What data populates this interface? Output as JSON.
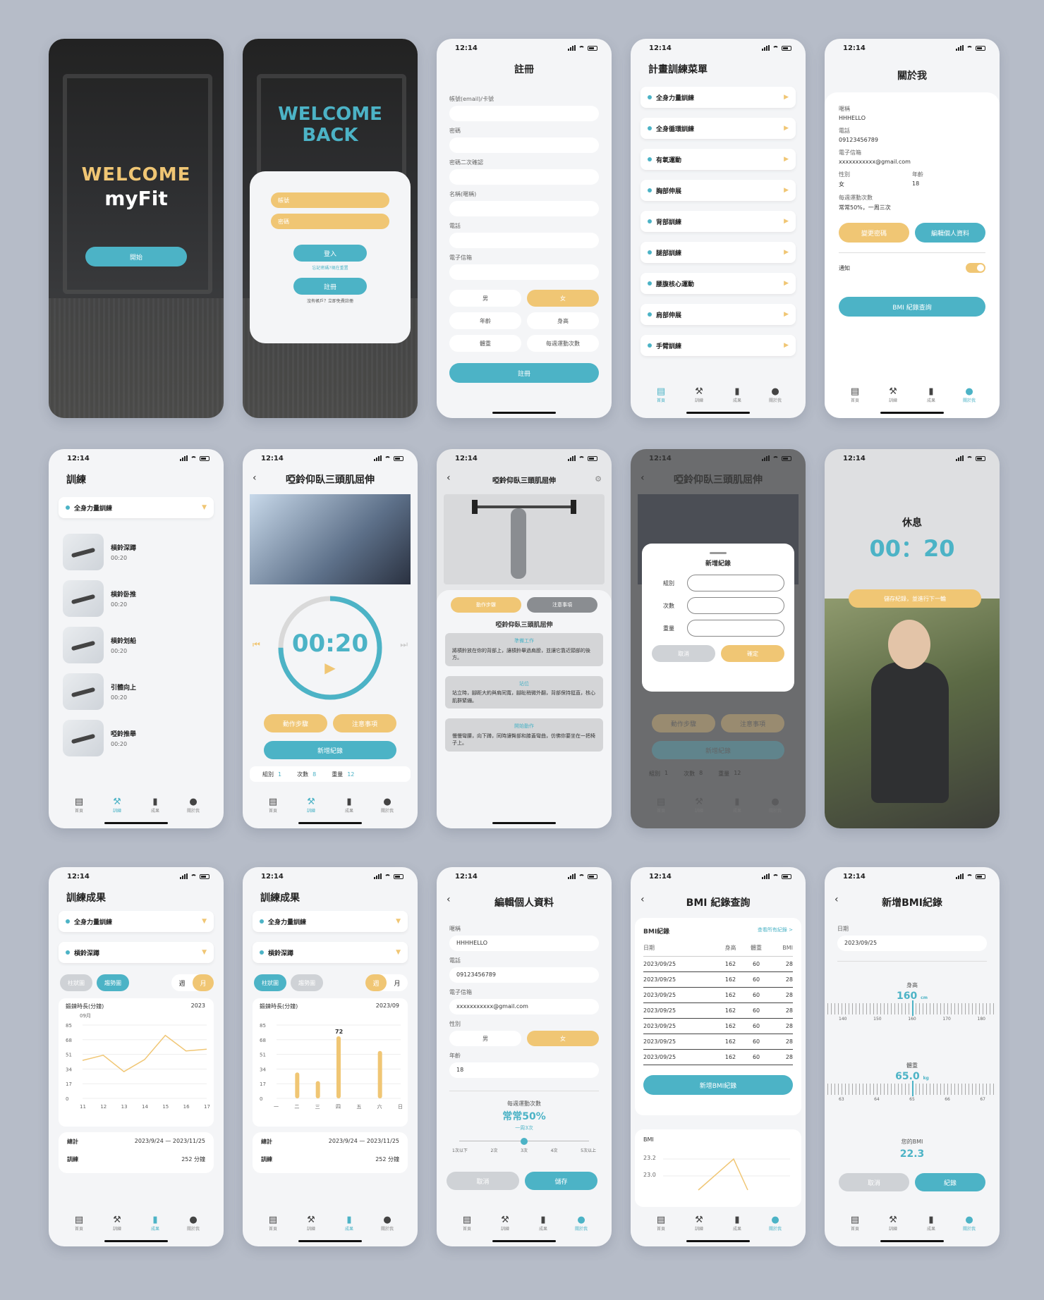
{
  "status": {
    "time": "12:14"
  },
  "nav": [
    "首頁",
    "訓練",
    "成果",
    "關於我"
  ],
  "s1": {
    "welcome": "WELCOME",
    "brand": "myFit",
    "start": "開始"
  },
  "s2": {
    "welcome1": "WELCOME",
    "welcome2": "BACK",
    "account": "帳號",
    "password": "密碼",
    "login": "登入",
    "forgot": "忘記密碼?現在重置",
    "register": "註冊",
    "no_account": "沒有帳戶？立即免費註冊"
  },
  "s3": {
    "title": "註冊",
    "fields": [
      "帳號(email)/卡號",
      "密碼",
      "密碼二次確認",
      "名稱(暱稱)",
      "電話",
      "電子信箱"
    ],
    "male": "男",
    "female": "女",
    "age": "年齡",
    "height": "身高",
    "weight": "體重",
    "freq": "每週運動次數",
    "submit": "註冊"
  },
  "s4": {
    "title": "計畫訓練菜單",
    "items": [
      "全身力量訓練",
      "全身循環訓練",
      "有氧運動",
      "胸部伸展",
      "背部訓練",
      "腿部訓練",
      "腰腹核心運動",
      "肩部伸展",
      "手臂訓練"
    ]
  },
  "s5": {
    "title": "關於我",
    "nick_l": "暱稱",
    "nick": "HHHELLO",
    "phone_l": "電話",
    "phone": "09123456789",
    "email_l": "電子信箱",
    "email": "xxxxxxxxxxx@gmail.com",
    "gender_l": "性別",
    "gender": "女",
    "age_l": "年齡",
    "age": "18",
    "freq_l": "每週運動次數",
    "freq": "常常50%，一周三次",
    "change_pw": "變更密碼",
    "edit": "編輯個人資料",
    "notify": "通知",
    "bmi": "BMI 紀錄查詢"
  },
  "s6": {
    "title": "訓練",
    "select": "全身力量訓練",
    "list": [
      {
        "name": "槓鈴深蹲",
        "time": "00:20"
      },
      {
        "name": "槓鈴卧推",
        "time": "00:20"
      },
      {
        "name": "槓鈴划船",
        "time": "00:20"
      },
      {
        "name": "引體向上",
        "time": "00:20"
      },
      {
        "name": "啞鈴推舉",
        "time": "00:20"
      }
    ]
  },
  "s7": {
    "title": "啞鈴仰臥三頭肌屈伸",
    "timer": "00:20",
    "steps": "動作步驟",
    "notes": "注意事項",
    "add": "新增紀錄",
    "sets_l": "組別",
    "sets": "1",
    "reps_l": "次數",
    "reps": "8",
    "wt_l": "重量",
    "wt": "12"
  },
  "s8": {
    "title": "啞鈴仰臥三頭肌屈伸",
    "tab1": "動作步驟",
    "tab2": "注意事項",
    "sub": "啞鈴仰臥三頭肌屈伸",
    "b1h": "準備工作",
    "b1": "將槓鈴放在你的背部上，讓槓鈴舉過肩膀，並讓它靠近頸部的後方。",
    "b2h": "站位",
    "b2": "站立時，腳距大約與肩同寬，腳趾稍微外翻，背部保持挺直，核心肌群緊繃。",
    "b3h": "開始動作",
    "b3": "慢慢彎腰，向下蹲，同時讓臀部和膝蓋彎曲，仿佛你要坐在一把椅子上。"
  },
  "s9": {
    "title": "啞鈴仰臥三頭肌屈伸",
    "modal": "新增紀錄",
    "sets": "組別",
    "reps": "次數",
    "wt": "重量",
    "cancel": "取消",
    "ok": "確定",
    "steps": "動作步驟",
    "notes": "注意事項",
    "add": "新增紀錄",
    "sets_l": "組別",
    "sets_v": "1",
    "reps_l": "次數",
    "reps_v": "8",
    "wt_l": "重量",
    "wt_v": "12"
  },
  "s10": {
    "rest": "休息",
    "timer": "00：20",
    "save": "儲存紀錄，並進行下一輪"
  },
  "s11": {
    "title": "訓練成果",
    "sel1": "全身力量訓練",
    "sel2": "槓鈴深蹲",
    "bar": "柱狀圖",
    "trend": "趨勢圖",
    "week": "週",
    "month": "月",
    "clabel": "鍛鍊時長(分鐘)",
    "year": "2023",
    "month_label": "09月",
    "total": "總計",
    "range": "2023/9/24 — 2023/11/25",
    "train": "訓練",
    "minutes": "252  分鐘"
  },
  "s12": {
    "title": "訓練成果",
    "sel1": "全身力量訓練",
    "sel2": "槓鈴深蹲",
    "bar": "柱狀圖",
    "trend": "趨勢圖",
    "week": "週",
    "month": "月",
    "clabel": "鍛鍊時長(分鐘)",
    "ym": "2023/09",
    "total": "總計",
    "range": "2023/9/24 — 2023/11/25",
    "train": "訓練",
    "minutes": "252  分鐘"
  },
  "s13": {
    "title": "編輯個人資料",
    "nick_l": "暱稱",
    "nick": "HHHHELLO",
    "phone_l": "電話",
    "phone": "09123456789",
    "email_l": "電子信箱",
    "email": "xxxxxxxxxxx@gmail.com",
    "gender_l": "性別",
    "male": "男",
    "female": "女",
    "age_l": "年齡",
    "age": "18",
    "freq_l": "每週運動次數",
    "freq": "常常50%",
    "freq_sub": "一周3次",
    "ticks": [
      "1次以下",
      "2次",
      "3次",
      "4次",
      "5次以上"
    ],
    "cancel": "取消",
    "save": "儲存"
  },
  "s14": {
    "title": "BMI 紀錄查詢",
    "rec": "BMI紀錄",
    "all": "查看所有紀錄 >",
    "cols": [
      "日期",
      "身高",
      "體重",
      "BMI"
    ],
    "rows": [
      [
        "2023/09/25",
        "162",
        "60",
        "28"
      ],
      [
        "2023/09/25",
        "162",
        "60",
        "28"
      ],
      [
        "2023/09/25",
        "162",
        "60",
        "28"
      ],
      [
        "2023/09/25",
        "162",
        "60",
        "28"
      ],
      [
        "2023/09/25",
        "162",
        "60",
        "28"
      ],
      [
        "2023/09/25",
        "162",
        "60",
        "28"
      ],
      [
        "2023/09/25",
        "162",
        "60",
        "28"
      ]
    ],
    "add": "新增BMI紀錄",
    "bmi_l": "BMI",
    "y1": "23.2",
    "y2": "23.0"
  },
  "s15": {
    "title": "新增BMI紀錄",
    "date_l": "日期",
    "date": "2023/09/25",
    "h_l": "身高",
    "h": "160",
    "h_u": "cm",
    "h_ticks": [
      "140",
      "150",
      "160",
      "170",
      "180"
    ],
    "w_l": "體重",
    "w": "65.0",
    "w_u": "kg",
    "w_ticks": [
      "63",
      "64",
      "65",
      "66",
      "67"
    ],
    "your": "您的BMI",
    "bmi": "22.3",
    "cancel": "取消",
    "rec": "紀錄"
  },
  "chart_data": [
    {
      "type": "line",
      "title": "鍛鍊時長(分鐘)",
      "x": [
        "11",
        "12",
        "13",
        "14",
        "15",
        "16",
        "17"
      ],
      "values": [
        44,
        50,
        31,
        45,
        73,
        55,
        57
      ],
      "yticks": [
        "85",
        "68",
        "51",
        "34",
        "17",
        "0"
      ],
      "ylim": [
        0,
        85
      ]
    },
    {
      "type": "bar",
      "title": "鍛鍊時長(分鐘)",
      "categories": [
        "一",
        "二",
        "三",
        "四",
        "五",
        "六",
        "日"
      ],
      "values": [
        0,
        30,
        20,
        72,
        0,
        55,
        0
      ],
      "yticks": [
        "85",
        "68",
        "51",
        "34",
        "17",
        "0"
      ],
      "ylim": [
        0,
        85
      ],
      "labels": [
        "72"
      ]
    }
  ],
  "colors": {
    "teal": "#4cb3c6",
    "amber": "#f0c674"
  }
}
